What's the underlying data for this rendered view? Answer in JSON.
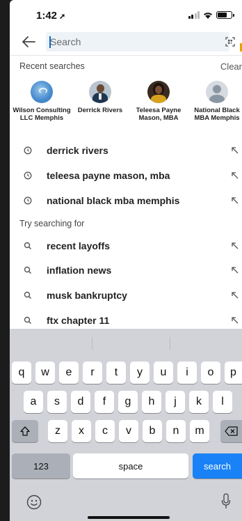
{
  "status": {
    "time": "1:42"
  },
  "search": {
    "placeholder": "Search"
  },
  "recent": {
    "title": "Recent searches",
    "clear_label": "Clear",
    "profiles": [
      {
        "name": "Wilson Consulting LLC Memphis"
      },
      {
        "name": "Derrick Rivers"
      },
      {
        "name": "Teleesa Payne Mason, MBA"
      },
      {
        "name": "National Black MBA Memphis"
      }
    ],
    "queries": [
      "derrick rivers",
      "teleesa payne mason, mba",
      "national black mba memphis"
    ]
  },
  "suggestions": {
    "title": "Try searching for",
    "items": [
      "recent layoffs",
      "inflation news",
      "musk bankruptcy",
      "ftx chapter 11"
    ]
  },
  "keyboard": {
    "row1": [
      "q",
      "w",
      "e",
      "r",
      "t",
      "y",
      "u",
      "i",
      "o",
      "p"
    ],
    "row2": [
      "a",
      "s",
      "d",
      "f",
      "g",
      "h",
      "j",
      "k",
      "l"
    ],
    "row3": [
      "z",
      "x",
      "c",
      "v",
      "b",
      "n",
      "m"
    ],
    "numbers_label": "123",
    "space_label": "space",
    "search_label": "search"
  },
  "colors": {
    "accent": "#0a66c2",
    "keyboard_search": "#1a82f7",
    "keyboard_bg": "#d1d3d9"
  }
}
